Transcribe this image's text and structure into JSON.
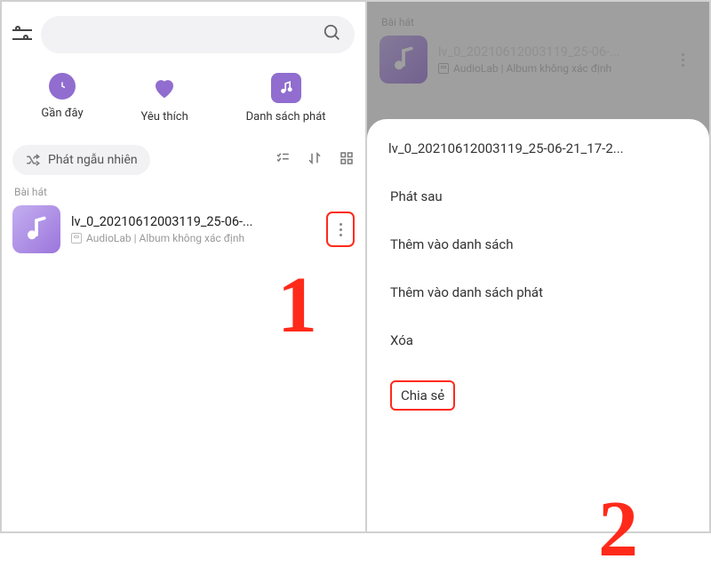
{
  "left": {
    "quick": {
      "recent": "Gần đây",
      "favorite": "Yêu thích",
      "playlist": "Danh sách phát"
    },
    "shuffle_label": "Phát ngẫu nhiên",
    "songs_header": "Bài hát",
    "track": {
      "title": "lv_0_20210612003119_25-06-...",
      "subtitle": "AudioLab | Album không xác định"
    }
  },
  "right": {
    "songs_header": "Bài hát",
    "track": {
      "title": "lv_0_20210612003119_25-06-...",
      "subtitle": "AudioLab | Album không xác định"
    },
    "sheet": {
      "title": "lv_0_20210612003119_25-06-21_17-2...",
      "play_next": "Phát sau",
      "add_to_list": "Thêm vào danh sách",
      "add_to_playlist": "Thêm vào danh sách phát",
      "delete": "Xóa",
      "share": "Chia sẻ"
    }
  },
  "annotations": {
    "one": "1",
    "two": "2"
  }
}
